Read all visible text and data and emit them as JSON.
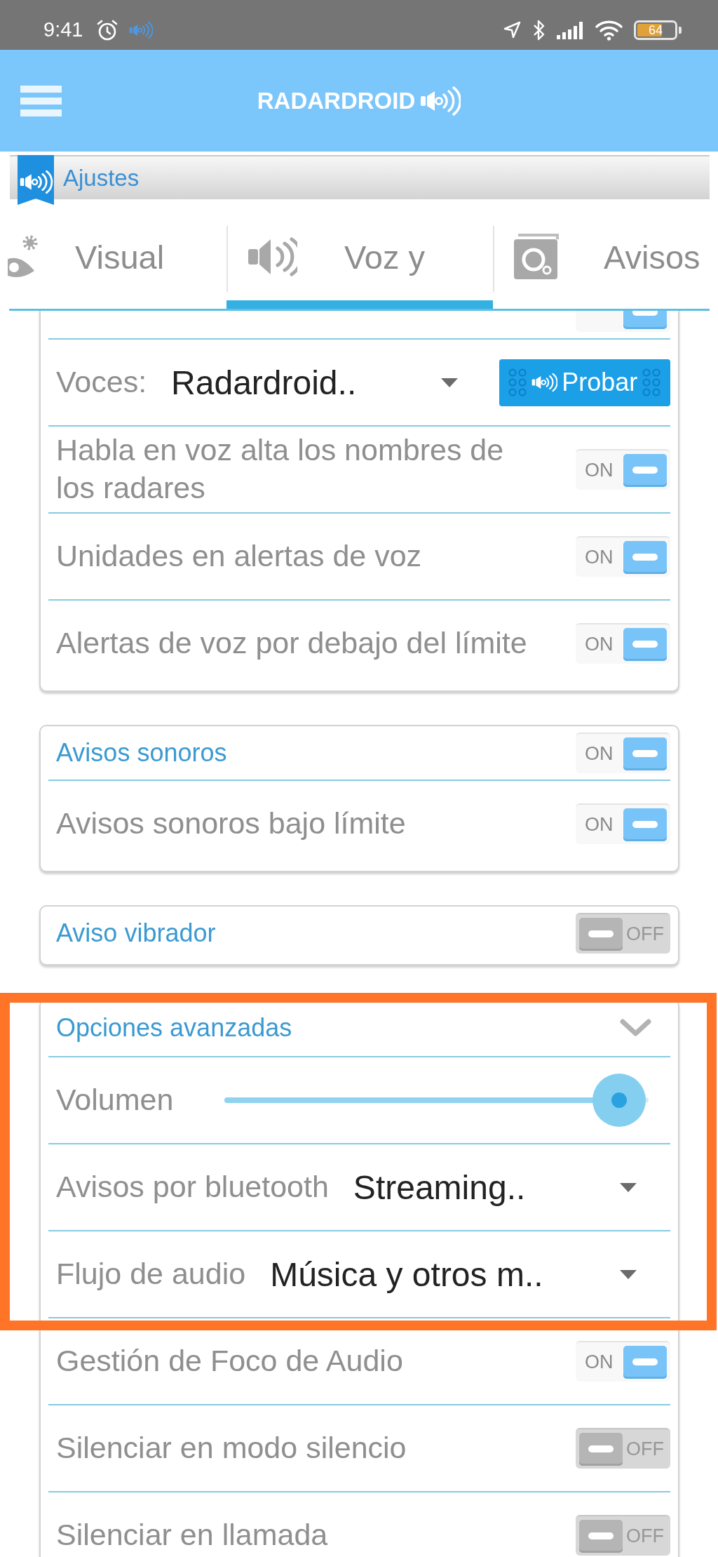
{
  "status_bar": {
    "time": "9:41",
    "battery": "64"
  },
  "app_bar": {
    "logo_text": "RADARDROID"
  },
  "section_bar": {
    "title": "Ajustes"
  },
  "tabs": [
    {
      "label": "Visual",
      "selected": false
    },
    {
      "label": "Voz y",
      "selected": true
    },
    {
      "label": "Avisos",
      "selected": false
    }
  ],
  "cards": [
    {
      "groups": [
        {
          "highlighted": false,
          "rows": [
            {
              "kind": "toggle_header",
              "on": true
            },
            {
              "kind": "select",
              "label": "Voces:",
              "value": "Radardroid..",
              "button": "Probar"
            },
            {
              "kind": "toggle",
              "label": "Habla en voz alta los nombres de los radares",
              "on": true,
              "switch_text": "ON"
            },
            {
              "kind": "toggle",
              "label": "Unidades en alertas de voz",
              "on": true,
              "switch_text": "ON"
            },
            {
              "kind": "toggle",
              "label": "Alertas de voz por debajo del límite",
              "on": true,
              "switch_text": "ON"
            }
          ]
        }
      ]
    },
    {
      "groups": [
        {
          "highlighted": false,
          "rows": [
            {
              "kind": "toggle_header",
              "label": "Avisos sonoros",
              "on": true,
              "switch_text": "ON"
            },
            {
              "kind": "toggle",
              "label": "Avisos sonoros bajo límite",
              "on": true,
              "switch_text": "ON"
            }
          ]
        }
      ]
    },
    {
      "groups": [
        {
          "highlighted": false,
          "rows": [
            {
              "kind": "toggle_header",
              "label": "Aviso vibrador",
              "on": false,
              "switch_text": "OFF"
            }
          ]
        }
      ]
    },
    {
      "groups": [
        {
          "highlighted": true,
          "rows": [
            {
              "kind": "expander_header",
              "label": "Opciones avanzadas",
              "expanded": true
            },
            {
              "kind": "slider",
              "label": "Volumen",
              "level": 0.93
            },
            {
              "kind": "select",
              "label": "Avisos por bluetooth",
              "value": "Streaming.."
            },
            {
              "kind": "select",
              "label": "Flujo de audio",
              "value": "Música y otros m.."
            }
          ]
        },
        {
          "highlighted": false,
          "rows": [
            {
              "kind": "toggle",
              "label": "Gestión de Foco de Audio",
              "on": true,
              "switch_text": "ON"
            },
            {
              "kind": "toggle",
              "label": "Silenciar en modo silencio",
              "on": false,
              "switch_text": "OFF"
            },
            {
              "kind": "toggle",
              "label": "Silenciar en llamada",
              "on": false,
              "switch_text": "OFF"
            }
          ]
        }
      ]
    }
  ]
}
